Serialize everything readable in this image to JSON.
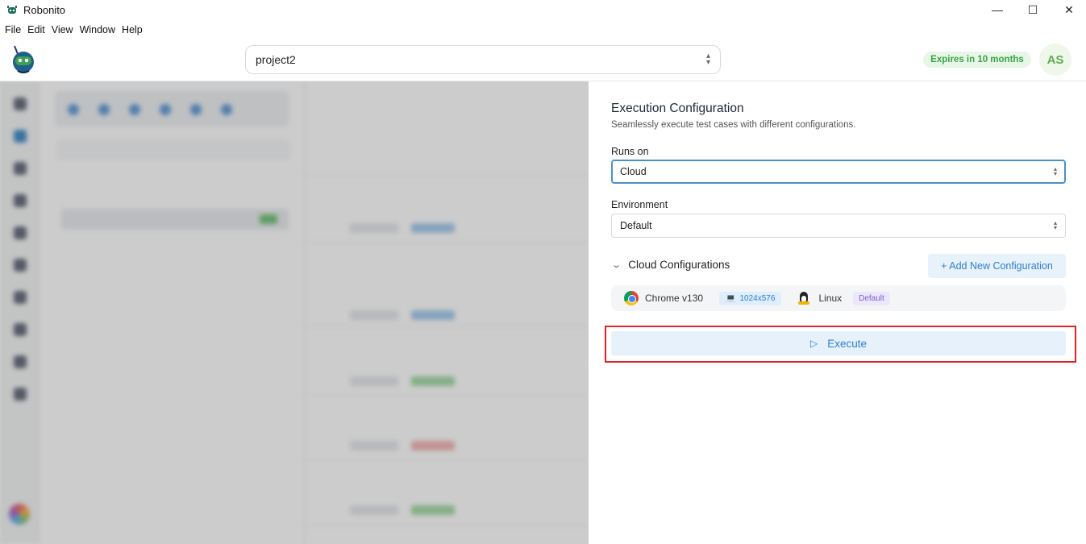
{
  "window": {
    "title": "Robonito",
    "minimize": "—",
    "maximize": "☐",
    "close": "✕"
  },
  "menu": [
    "File",
    "Edit",
    "View",
    "Window",
    "Help"
  ],
  "header": {
    "project": "project2",
    "expires": "Expires in 10 months",
    "avatar": "AS"
  },
  "colors": {
    "accent": "#2f7fd0",
    "expires_bg": "#e7f6e7",
    "expires_fg": "#3aa445",
    "highlight": "#e02424"
  },
  "drawer": {
    "title": "Execution Configuration",
    "subtitle": "Seamlessly execute test cases with different configurations.",
    "runs_on_label": "Runs on",
    "runs_on_value": "Cloud",
    "environment_label": "Environment",
    "environment_value": "Default",
    "cloud_configs_label": "Cloud Configurations",
    "add_config": "+ Add New Configuration",
    "config": {
      "browser": "Chrome v130",
      "resolution": "1024x576",
      "os": "Linux",
      "badge": "Default"
    },
    "execute": "Execute"
  }
}
